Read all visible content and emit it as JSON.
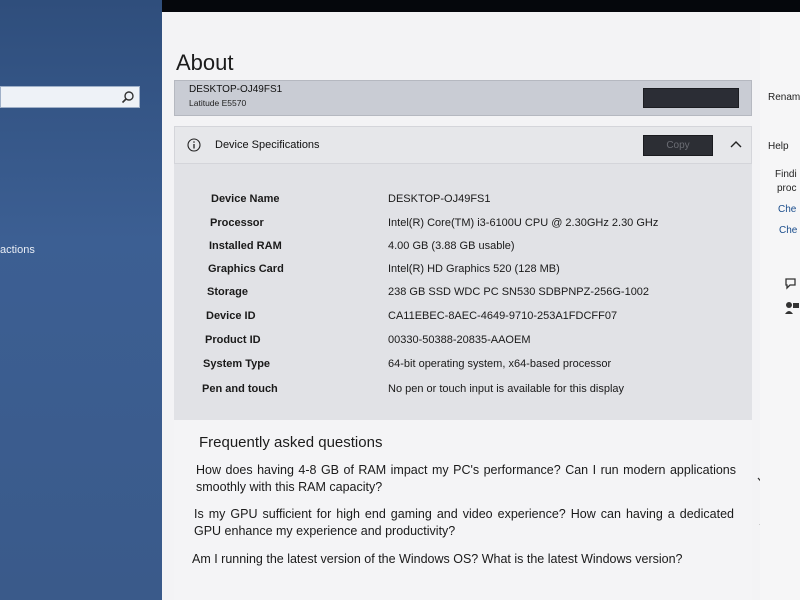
{
  "left_panel": {
    "partial_text": "actions"
  },
  "about": {
    "title": "About",
    "device_name": "DESKTOP-OJ49FS1",
    "device_model": "Latitude E5570",
    "rename_button_label": ""
  },
  "specs": {
    "section_title": "Device Specifications",
    "copy_label": "Copy",
    "rows": [
      {
        "label": "Device Name",
        "value": "DESKTOP-OJ49FS1"
      },
      {
        "label": "Processor",
        "value": "Intel(R) Core(TM) i3-6100U CPU @ 2.30GHz   2.30 GHz"
      },
      {
        "label": "Installed RAM",
        "value": "4.00 GB (3.88 GB usable)"
      },
      {
        "label": "Graphics Card",
        "value": "Intel(R) HD Graphics 520 (128 MB)"
      },
      {
        "label": "Storage",
        "value": "238 GB SSD WDC PC SN530 SDBPNPZ-256G-1002"
      },
      {
        "label": "Device ID",
        "value": "CA11EBEC-8AEC-4649-9710-253A1FDCFF07"
      },
      {
        "label": "Product ID",
        "value": "00330-50388-20835-AAOEM"
      },
      {
        "label": "System Type",
        "value": "64-bit operating system, x64-based processor"
      },
      {
        "label": "Pen and touch",
        "value": "No pen or touch input is available for this display"
      }
    ]
  },
  "faq": {
    "title": "Frequently asked questions",
    "items": [
      "How does having 4-8 GB of RAM impact my PC's performance? Can I run modern applications smoothly with this RAM capacity?",
      "Is my GPU sufficient for high end gaming and video experience? How can having a dedicated GPU enhance my experience and productivity?",
      "Am I running the latest version of the Windows OS? What is the latest Windows version?"
    ]
  },
  "right_panel": {
    "rename_text": "Renam",
    "help_text": "Help",
    "line1": "Findi",
    "line2": "proc",
    "link1": "Che",
    "link2": "Che"
  },
  "colors": {
    "accent_button": "#2b2d35",
    "link": "#1a4d8c"
  }
}
